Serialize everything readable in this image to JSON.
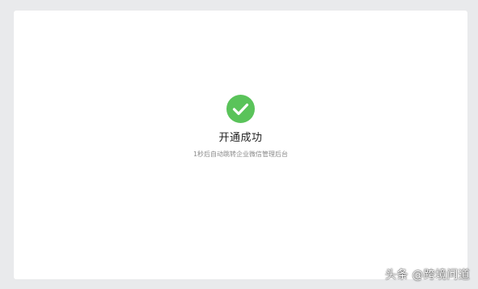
{
  "result": {
    "status_icon": "success-check-icon",
    "title": "开通成功",
    "subtitle": "1秒后自动跳转企业微信管理后台"
  },
  "watermark": {
    "text": "头条 @跨境问道"
  },
  "colors": {
    "background": "#e9eaec",
    "card": "#ffffff",
    "success": "#5ac35a",
    "title": "#222222",
    "subtitle": "#8a8a8a"
  }
}
